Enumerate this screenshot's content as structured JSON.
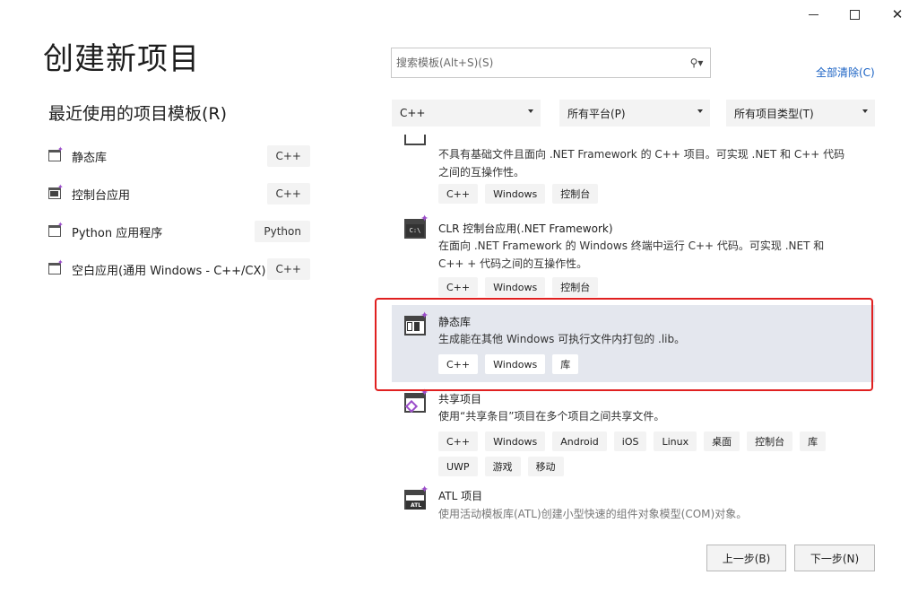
{
  "window": {
    "minimize_icon": "minimize-icon",
    "maximize_icon": "maximize-icon",
    "close_icon": "close-icon",
    "close_glyph": "✕"
  },
  "header": {
    "title": "创建新项目"
  },
  "recent": {
    "title": "最近使用的项目模板(R)",
    "items": [
      {
        "label": "静态库",
        "tag": "C++",
        "icon": "static-library-icon"
      },
      {
        "label": "控制台应用",
        "tag": "C++",
        "icon": "console-app-icon"
      },
      {
        "label": "Python 应用程序",
        "tag": "Python",
        "icon": "python-app-icon"
      },
      {
        "label": "空白应用(通用 Windows - C++/CX)",
        "tag": "C++",
        "icon": "blank-uwp-app-icon"
      }
    ]
  },
  "search": {
    "placeholder": "搜索模板(Alt+S)(S)",
    "button_glyph": "⚲▾",
    "clear_all": "全部清除(C)"
  },
  "filters": {
    "language": "C++",
    "platform": "所有平台(P)",
    "project_type": "所有项目类型(T)"
  },
  "templates": [
    {
      "name": "",
      "description": "不具有基础文件且面向 .NET Framework 的 C++ 项目。可实现 .NET 和 C++ 代码之间的互操作性。",
      "tags": [
        "C++",
        "Windows",
        "控制台"
      ],
      "icon": "clr-empty-project-icon"
    },
    {
      "name": "CLR 控制台应用(.NET Framework)",
      "description": "在面向 .NET Framework 的 Windows 终端中运行 C++ 代码。可实现 .NET 和 C++ + 代码之间的互操作性。",
      "tags": [
        "C++",
        "Windows",
        "控制台"
      ],
      "icon": "clr-console-app-icon",
      "icon_text": "C:\\"
    },
    {
      "name": "静态库",
      "description": "生成能在其他 Windows 可执行文件内打包的 .lib。",
      "tags": [
        "C++",
        "Windows",
        "库"
      ],
      "icon": "static-library-icon",
      "selected": true
    },
    {
      "name": "共享项目",
      "description": "使用“共享条目”项目在多个项目之间共享文件。",
      "tags": [
        "C++",
        "Windows",
        "Android",
        "iOS",
        "Linux",
        "桌面",
        "控制台",
        "库",
        "UWP",
        "游戏",
        "移动"
      ],
      "icon": "shared-project-icon"
    },
    {
      "name": "ATL 项目",
      "description": "使用活动模板库(ATL)创建小型快速的组件对象模型(COM)对象。",
      "tags": [],
      "icon": "atl-project-icon",
      "icon_text": "ATL"
    }
  ],
  "footer": {
    "back": "上一步(B)",
    "next": "下一步(N)"
  }
}
